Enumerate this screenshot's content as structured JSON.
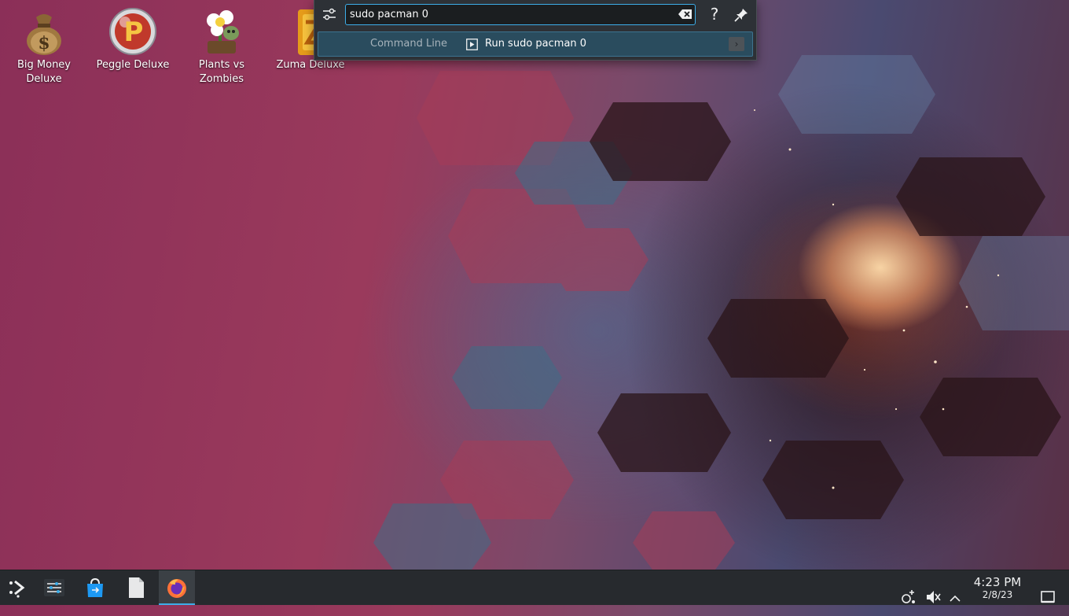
{
  "desktop": {
    "icons": [
      {
        "label": "Big Money\nDeluxe",
        "line1": "Big Money",
        "line2": "Deluxe"
      },
      {
        "label": "Peggle Deluxe",
        "line1": "Peggle Deluxe",
        "line2": ""
      },
      {
        "label": "Plants vs Zombies",
        "line1": "Plants vs",
        "line2": "Zombies"
      },
      {
        "label": "Zuma Deluxe",
        "line1": "Zuma Deluxe",
        "line2": ""
      }
    ]
  },
  "krunner": {
    "query": "sudo pacman 0",
    "help_glyph": "?",
    "result": {
      "category": "Command Line",
      "text": "Run sudo pacman 0",
      "action_glyph": "›"
    }
  },
  "taskbar": {
    "apps": [
      "application-launcher-icon",
      "system-settings-icon",
      "discover-store-icon",
      "file-icon",
      "firefox-icon"
    ],
    "clock": {
      "time": "4:23 PM",
      "date": "2/8/23"
    },
    "tray_icons": [
      "network-icon",
      "volume-muted-icon",
      "expand-tray-icon",
      "show-desktop-icon"
    ]
  },
  "colors": {
    "accent": "#3daee9",
    "panel": "#272a2e",
    "krunner_bg": "#2d3136",
    "selected_result": "#2a4c5e"
  }
}
